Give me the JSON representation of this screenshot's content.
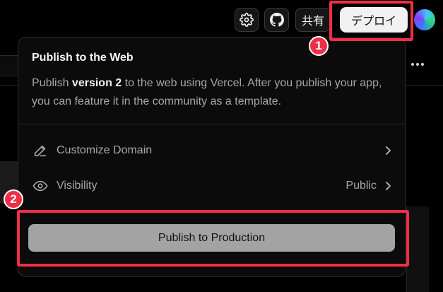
{
  "header": {
    "settings_icon": "gear-icon",
    "github_icon": "github-icon",
    "share_label": "共有",
    "deploy_label": "デプロイ"
  },
  "popover": {
    "title": "Publish to the Web",
    "desc_prefix": "Publish ",
    "desc_version": "version 2",
    "desc_suffix": " to the web using Vercel. After you publish your app, you can feature it in the community as a template.",
    "rows": [
      {
        "icon": "pencil-icon",
        "label": "Customize Domain",
        "value": ""
      },
      {
        "icon": "eye-icon",
        "label": "Visibility",
        "value": "Public"
      }
    ],
    "publish_label": "Publish to Production"
  },
  "annotations": {
    "badge_1": "1",
    "badge_2": "2",
    "highlight_color": "#ef2f45"
  },
  "colors": {
    "background": "#000000",
    "popover_bg": "#0b0b0b",
    "publish_button_bg": "#a3a3a3",
    "deploy_button_bg": "#f1f1f1"
  }
}
